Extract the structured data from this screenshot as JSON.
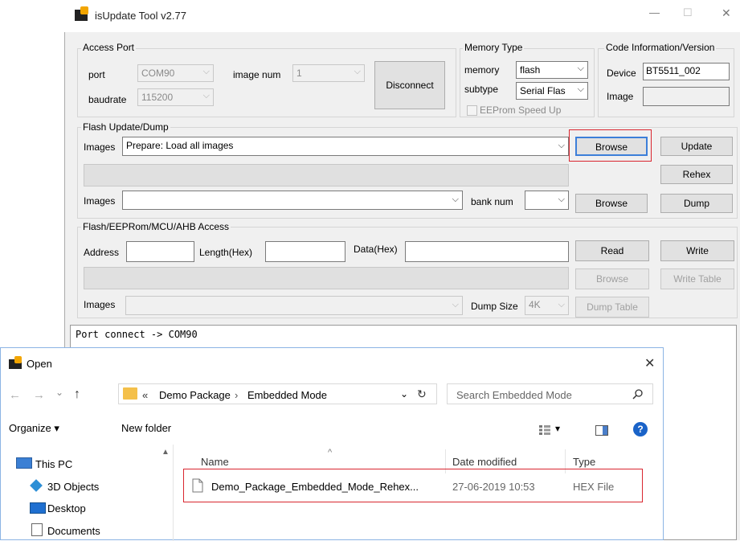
{
  "main_window": {
    "title": "isUpdate Tool v2.77",
    "controls": {
      "minimize": "—",
      "maximize": "☐",
      "close": "✕"
    }
  },
  "access_port": {
    "legend": "Access Port",
    "port_label": "port",
    "port_value": "COM90",
    "baudrate_label": "baudrate",
    "baudrate_value": "115200",
    "image_num_label": "image num",
    "image_num_value": "1",
    "disconnect_label": "Disconnect"
  },
  "memory_type": {
    "legend": "Memory Type",
    "memory_label": "memory",
    "memory_value": "flash",
    "subtype_label": "subtype",
    "subtype_value": "Serial Flas",
    "eeprom_label": "EEProm Speed Up",
    "eeprom_checked": false
  },
  "code_info": {
    "legend": "Code Information/Version",
    "device_label": "Device",
    "device_value": "BT5511_002",
    "image_label": "Image",
    "image_value": ""
  },
  "flash_update": {
    "legend": "Flash Update/Dump",
    "images_label": "Images",
    "images_value": "Prepare: Load all images",
    "browse_label": "Browse",
    "update_label": "Update",
    "rehex_label": "Rehex",
    "images2_label": "Images",
    "images2_value": "",
    "bank_num_label": "bank num",
    "bank_num_value": "",
    "browse2_label": "Browse",
    "dump_label": "Dump"
  },
  "flash_access": {
    "legend": "Flash/EEPRom/MCU/AHB Access",
    "address_label": "Address",
    "length_label": "Length(Hex)",
    "data_label": "Data(Hex)",
    "read_label": "Read",
    "write_label": "Write",
    "browse_label": "Browse",
    "write_table_label": "Write Table",
    "images_label": "Images",
    "dump_size_label": "Dump Size",
    "dump_size_value": "4K",
    "dump_table_label": "Dump Table"
  },
  "log": {
    "text": "Port connect -> COM90"
  },
  "open_dialog": {
    "title": "Open",
    "close": "✕",
    "nav": {
      "back": "←",
      "forward": "→",
      "recent": "⌄",
      "up": "↑"
    },
    "breadcrumb": {
      "prefix": "«",
      "folder1": "Demo Package",
      "sep": "›",
      "folder2": "Embedded Mode",
      "dropdown": "⌄",
      "refresh": "↻"
    },
    "search_placeholder": "Search Embedded Mode",
    "organize_label": "Organize ▾",
    "new_folder_label": "New folder",
    "view_dropdown": "▾",
    "help": "?",
    "sidebar": [
      "This PC",
      "3D Objects",
      "Desktop",
      "Documents"
    ],
    "columns": {
      "name": "Name",
      "date": "Date modified",
      "type": "Type"
    },
    "sort_indicator": "^",
    "files": [
      {
        "name": "Demo_Package_Embedded_Mode_Rehex...",
        "date": "27-06-2019 10:53",
        "type": "HEX File"
      }
    ]
  },
  "colors": {
    "highlight_red": "#d9262f",
    "help_blue": "#1a63c8",
    "selected_border": "#3c7fd9"
  }
}
